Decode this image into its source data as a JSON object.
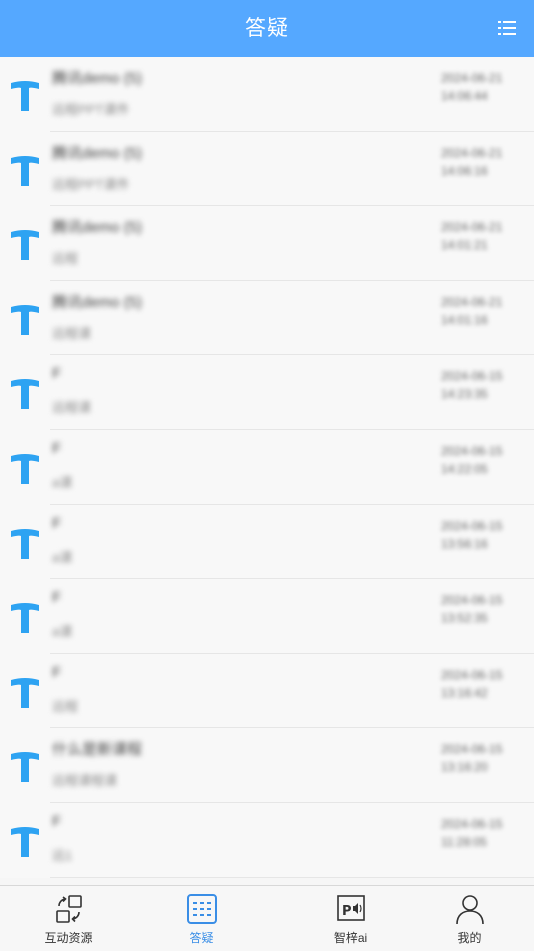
{
  "header": {
    "title": "答疑"
  },
  "items": [
    {
      "name": "腾讯demo (5)",
      "preview": "远程PPT课件",
      "date": "2024-06-21",
      "time": "14:06:44"
    },
    {
      "name": "腾讯demo (5)",
      "preview": "远程PPT课件",
      "date": "2024-06-21",
      "time": "14:06:16"
    },
    {
      "name": "腾讯demo (5)",
      "preview": "远程",
      "date": "2024-06-21",
      "time": "14:01:21"
    },
    {
      "name": "腾讯demo (5)",
      "preview": "远程课",
      "date": "2024-06-21",
      "time": "14:01:16"
    },
    {
      "name": "F",
      "preview": "远程课",
      "date": "2024-06-15",
      "time": "14:23:35"
    },
    {
      "name": "F",
      "preview": "a课",
      "date": "2024-06-15",
      "time": "14:22:05"
    },
    {
      "name": "F",
      "preview": "a课",
      "date": "2024-06-15",
      "time": "13:56:16"
    },
    {
      "name": "F",
      "preview": "a课",
      "date": "2024-06-15",
      "time": "13:52:35"
    },
    {
      "name": "F",
      "preview": "远程",
      "date": "2024-06-15",
      "time": "13:16:42"
    },
    {
      "name": "什么是新课程",
      "preview": "远程课程课",
      "date": "2024-06-15",
      "time": "13:16:20"
    },
    {
      "name": "F",
      "preview": "远1",
      "date": "2024-06-15",
      "time": "11:28:05"
    }
  ],
  "tabs": [
    {
      "label": "互动资源",
      "icon": "interactive-resources-icon"
    },
    {
      "label": "答疑",
      "icon": "qa-grid-icon"
    },
    {
      "label": "智梓ai",
      "icon": "ppt-audio-icon"
    },
    {
      "label": "我的",
      "icon": "person-icon"
    }
  ],
  "colors": {
    "primary": "#55a8ff",
    "avatar": "#2ea3f2",
    "tab_active": "#3a8ee6"
  }
}
